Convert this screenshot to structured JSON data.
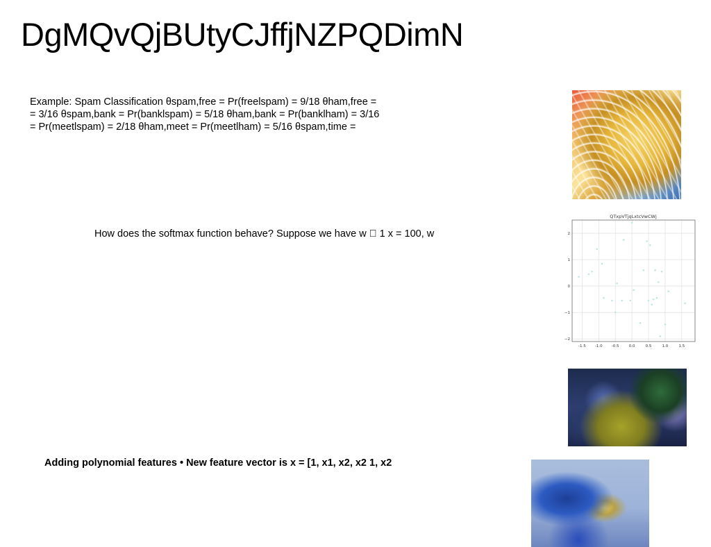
{
  "slide": {
    "title": "DgMQvQjBUtyCJffjNZPQDimN",
    "text_block_1": {
      "lines": [
        "Example: Spam Classification θspam,free = Pr(freelspam) = 9/18 θham,free =",
        "= 3/16 θspam,bank = Pr(banklspam) = 5/18 θham,bank = Pr(banklham) = 3/16",
        "= Pr(meetlspam) = 2/18 θham,meet = Pr(meetlham) = 5/16 θspam,time ="
      ]
    },
    "text_block_2": "How does the softmax function behave? Suppose we have w ⃞ 1 x = 100, w",
    "text_block_3": "Adding polynomial features • New feature vector is x = [1, x1, x2, x2 1, x2"
  },
  "images": {
    "waves": "abstract-waves-image",
    "party": "party-photo",
    "beach": "beach-photo"
  },
  "chart_data": {
    "type": "scatter",
    "title": "QTxpVTjqLxtcVwCWj",
    "xlabel": "",
    "ylabel": "",
    "xlim": [
      -1.8,
      1.9
    ],
    "ylim": [
      -2.1,
      2.5
    ],
    "xticks": [
      "-1.5",
      "-1.0",
      "-0.5",
      "0.0",
      "0.5",
      "1.0",
      "1.5"
    ],
    "xtick_values": [
      -1.5,
      -1.0,
      -0.5,
      0.0,
      0.5,
      1.0,
      1.5
    ],
    "yticks": [
      "2",
      "1",
      "0",
      "−1",
      "−2"
    ],
    "ytick_values": [
      2,
      1,
      0,
      -1,
      -2
    ],
    "grid": true,
    "color": "#bfe6e6",
    "x": [
      -1.6,
      -1.3,
      -1.2,
      -1.05,
      -0.9,
      -0.85,
      -0.6,
      -0.5,
      -0.45,
      -0.3,
      -0.25,
      -0.05,
      0.0,
      0.05,
      0.25,
      0.35,
      0.45,
      0.5,
      0.55,
      0.6,
      0.65,
      0.7,
      0.75,
      0.8,
      0.85,
      0.9,
      1.0,
      1.1,
      1.6
    ],
    "y": [
      0.35,
      0.45,
      0.55,
      1.4,
      0.85,
      -0.45,
      -0.55,
      -1.0,
      0.1,
      -0.55,
      1.75,
      -0.55,
      2.4,
      -0.15,
      -1.4,
      0.6,
      1.7,
      -0.55,
      1.55,
      -0.7,
      -0.5,
      0.6,
      -0.45,
      0.15,
      -1.9,
      0.55,
      -1.45,
      -0.2,
      -0.65
    ]
  }
}
